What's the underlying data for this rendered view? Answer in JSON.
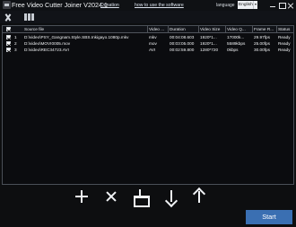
{
  "app": {
    "title": "Free Video Cutter Joiner V2024.1",
    "donation": "Donation",
    "how_to": "how to use the software",
    "language_label": "language",
    "language": "English"
  },
  "table": {
    "headers": [
      "Source file",
      "Video ...",
      "Duration",
      "Video Size",
      "Video Q...",
      "Frame R...",
      "Status"
    ],
    "rows": [
      [
        "1",
        "D:\\video\\PSY_Gangnam.Style.SBS.Inkigayo.1080p.mkv",
        "mkv",
        "00:04:08.603",
        "1920*1...",
        "17000k...",
        "29.97fps",
        "Ready"
      ],
      [
        "2",
        "D:\\video\\MOVI0005.mov",
        "mov",
        "00:03:05.000",
        "1920*1...",
        "5589kbps",
        "25.00fps",
        "Ready"
      ],
      [
        "3",
        "D:\\video\\REC34723.AVI",
        "AVI",
        "00:02:59.800",
        "1280*720",
        "0kbps",
        "30.00fps",
        "Ready"
      ]
    ]
  },
  "actions": {
    "start": "Start"
  },
  "icons": {
    "app": "video-app-icon",
    "cut": "scissors-icon",
    "join": "join-icon",
    "add": "plus-icon",
    "remove": "close-icon",
    "clear": "broom-icon",
    "down": "arrow-down-icon",
    "up": "arrow-up-icon"
  },
  "colors": {
    "background": "#0d0e10",
    "accent": "#3a6fb2"
  }
}
